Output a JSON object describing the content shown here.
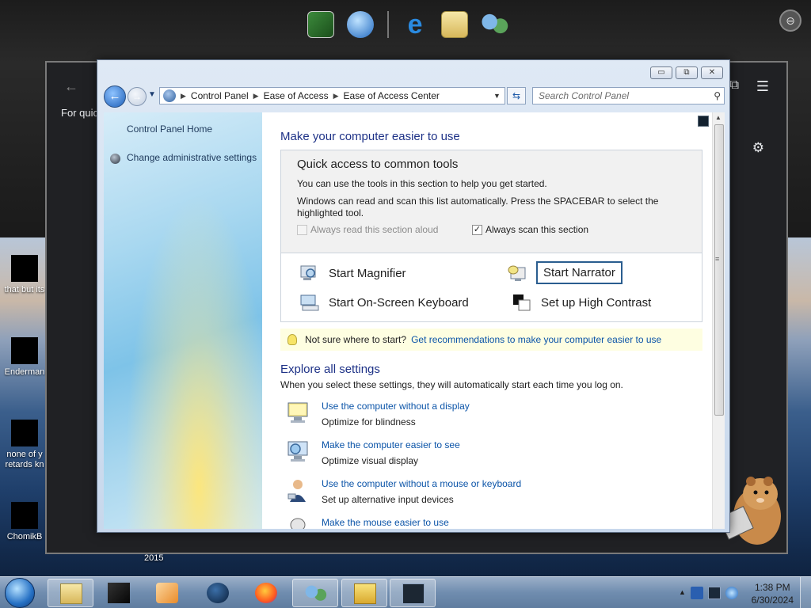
{
  "window": {
    "controls": {
      "minimize": "▭",
      "maximize": "⧉",
      "close": "✕"
    },
    "breadcrumb": [
      "Control Panel",
      "Ease of Access",
      "Ease of Access Center"
    ],
    "search_placeholder": "Search Control Panel"
  },
  "left_pane": {
    "links": [
      "Control Panel Home",
      "Change administrative settings"
    ]
  },
  "main": {
    "heading": "Make your computer easier to use",
    "quick_access": {
      "title": "Quick access to common tools",
      "desc1": "You can use the tools in this section to help you get started.",
      "desc2": "Windows can read and scan this list automatically.  Press the SPACEBAR to select the highlighted tool.",
      "check_read_label": "Always read this section aloud",
      "check_read_checked": false,
      "check_scan_label": "Always scan this section",
      "check_scan_checked": true,
      "tools": [
        "Start Magnifier",
        "Start Narrator",
        "Start On-Screen Keyboard",
        "Set up High Contrast"
      ]
    },
    "hint": {
      "text": "Not sure where to start?",
      "link": "Get recommendations to make your computer easier to use"
    },
    "explore": {
      "heading": "Explore all settings",
      "desc": "When you select these settings, they will automatically start each time you log on.",
      "items": [
        {
          "link": "Use the computer without a display",
          "sub": "Optimize for blindness"
        },
        {
          "link": "Make the computer easier to see",
          "sub": "Optimize visual display"
        },
        {
          "link": "Use the computer without a mouse or keyboard",
          "sub": "Set up alternative input devices"
        },
        {
          "link": "Make the mouse easier to use",
          "sub": ""
        }
      ]
    }
  },
  "background_browser": {
    "partial_text": "For quick"
  },
  "desktop_icons": [
    {
      "label": "that but its"
    },
    {
      "label": "Enderman"
    },
    {
      "label": "none of y retards kn"
    },
    {
      "label": "ChomikB"
    }
  ],
  "desktop_year_label": "2015",
  "taskbar": {
    "clock_time": "1:38 PM",
    "clock_date": "6/30/2024"
  },
  "colors": {
    "link": "#0b54a8",
    "heading": "#1e3287",
    "taskbar": "#7a96b8"
  }
}
